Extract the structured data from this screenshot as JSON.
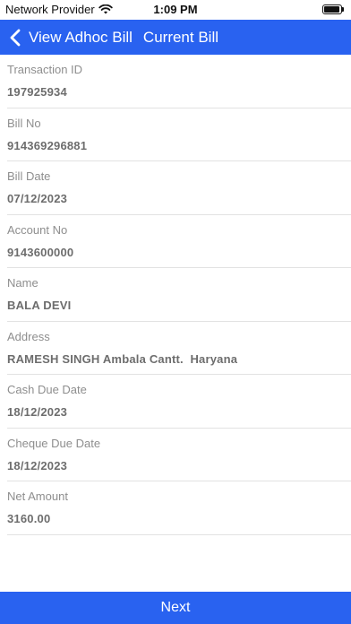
{
  "status_bar": {
    "carrier": "Network Provider",
    "time": "1:09 PM",
    "wifi_icon": "wifi-icon",
    "battery_icon": "battery-full-icon"
  },
  "nav": {
    "back_label": "View Adhoc Bill",
    "title": "Current Bill",
    "back_icon": "chevron-left-icon",
    "background_color": "#2962f0"
  },
  "fields": [
    {
      "label": "Transaction ID",
      "value": "197925934"
    },
    {
      "label": "Bill No",
      "value": "914369296881"
    },
    {
      "label": "Bill Date",
      "value": "07/12/2023"
    },
    {
      "label": "Account No",
      "value": "9143600000"
    },
    {
      "label": "Name",
      "value": "BALA DEVI"
    },
    {
      "label": "Address",
      "value": "RAMESH SINGH Ambala Cantt.  Haryana"
    },
    {
      "label": "Cash Due Date",
      "value": "18/12/2023"
    },
    {
      "label": "Cheque Due Date",
      "value": "18/12/2023"
    },
    {
      "label": "Net Amount",
      "value": "3160.00"
    }
  ],
  "footer": {
    "next_label": "Next"
  }
}
